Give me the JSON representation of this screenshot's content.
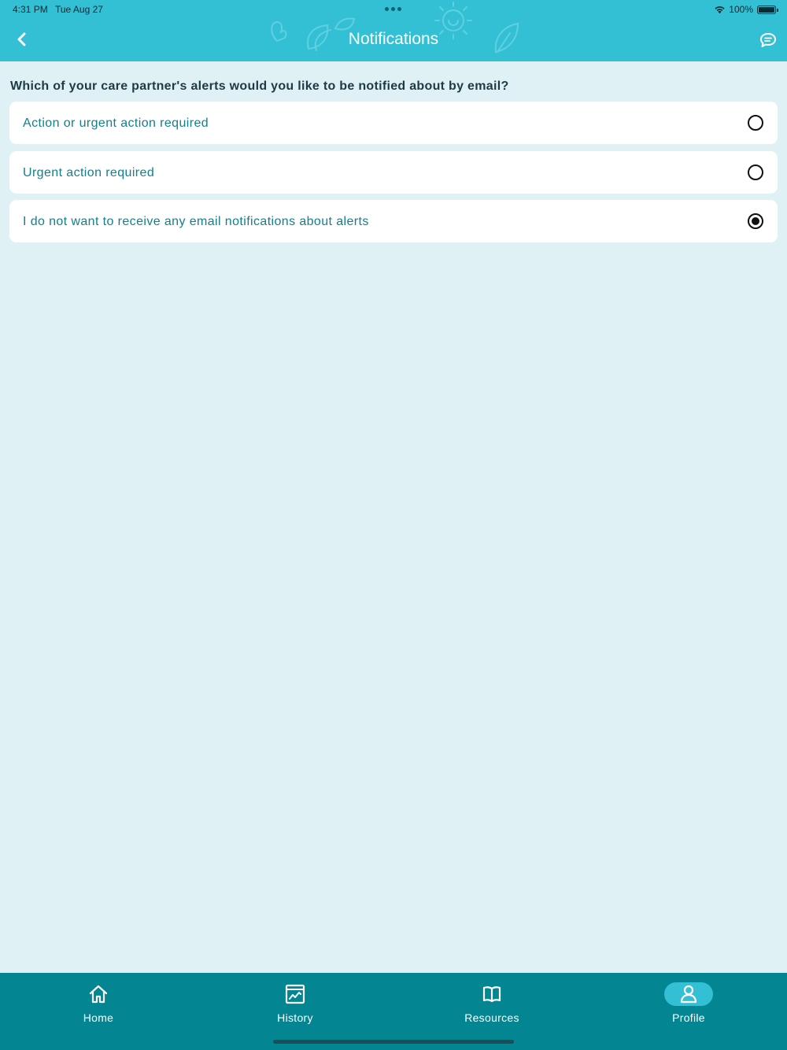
{
  "status_bar": {
    "time": "4:31 PM",
    "date": "Tue Aug 27",
    "battery": "100%"
  },
  "header": {
    "title": "Notifications",
    "back_icon": "chevron-left-icon",
    "chat_icon": "chat-bubble-icon"
  },
  "question": "Which of your care partner's alerts would you like to be notified about by email?",
  "options": [
    {
      "label": "Action or urgent action required",
      "selected": false
    },
    {
      "label": "Urgent action required",
      "selected": false
    },
    {
      "label": "I do not want to receive any email notifications about alerts",
      "selected": true
    }
  ],
  "tabs": [
    {
      "label": "Home",
      "icon": "home-icon",
      "active": false
    },
    {
      "label": "History",
      "icon": "chart-icon",
      "active": false
    },
    {
      "label": "Resources",
      "icon": "book-icon",
      "active": false
    },
    {
      "label": "Profile",
      "icon": "user-icon",
      "active": true
    }
  ],
  "colors": {
    "header": "#33c0d4",
    "background": "#dff1f5",
    "tab_bar": "#038592",
    "option_text": "#137f8c"
  }
}
